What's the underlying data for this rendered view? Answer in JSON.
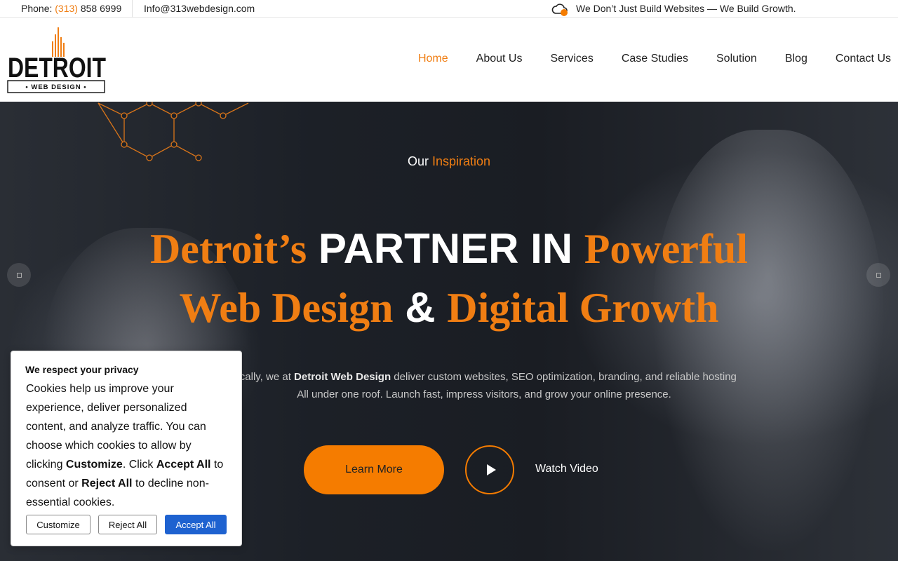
{
  "topbar": {
    "phone_label": "Phone:",
    "phone_number": "(313)",
    "phone_rest": "858 6999",
    "email": "Info@313webdesign.com",
    "tagline": "We Don’t Just Build Websites — We Build Growth.",
    "tagline_icon": "cloud-icon"
  },
  "logo": {
    "line1": "DETROIT",
    "line2": "WEB DESIGN"
  },
  "nav": [
    {
      "label": "Home",
      "active": true
    },
    {
      "label": "About Us"
    },
    {
      "label": "Services"
    },
    {
      "label": "Case Studies"
    },
    {
      "label": "Solution"
    },
    {
      "label": "Blog"
    },
    {
      "label": "Contact Us"
    }
  ],
  "hero": {
    "eyebrow_plain": "Our",
    "eyebrow_accent": "Inspiration",
    "headline": {
      "l1_a": "Detroit’s",
      "l1_b": "PARTNER IN",
      "l1_c": "Powerful",
      "l2_a": "Web Design",
      "l2_b": "&",
      "l2_c": "Digital Growth"
    },
    "desc_pre": "locally, we at",
    "desc_brand": "Detroit Web Design",
    "desc_post": "deliver custom websites, SEO optimization, branding, and reliable hosting",
    "desc_line2": "All under one roof. Launch fast, impress visitors, and grow your online presence.",
    "learn_more": "Learn More",
    "watch_video": "Watch Video"
  },
  "cookie": {
    "title": "We respect your privacy",
    "t1": "Cookies help us improve your experience, deliver personalized content, and analyze traffic. You can choose which cookies to allow by clicking",
    "b1": "Customize",
    "t2": ". Click",
    "b2": "Accept All",
    "t3": "to consent or",
    "b3": "Reject All",
    "t4": "to decline non-essential cookies.",
    "customize": "Customize",
    "reject": "Reject All",
    "accept": "Accept All"
  },
  "colors": {
    "accent": "#f07e13",
    "accept_button": "#1e62d0"
  }
}
